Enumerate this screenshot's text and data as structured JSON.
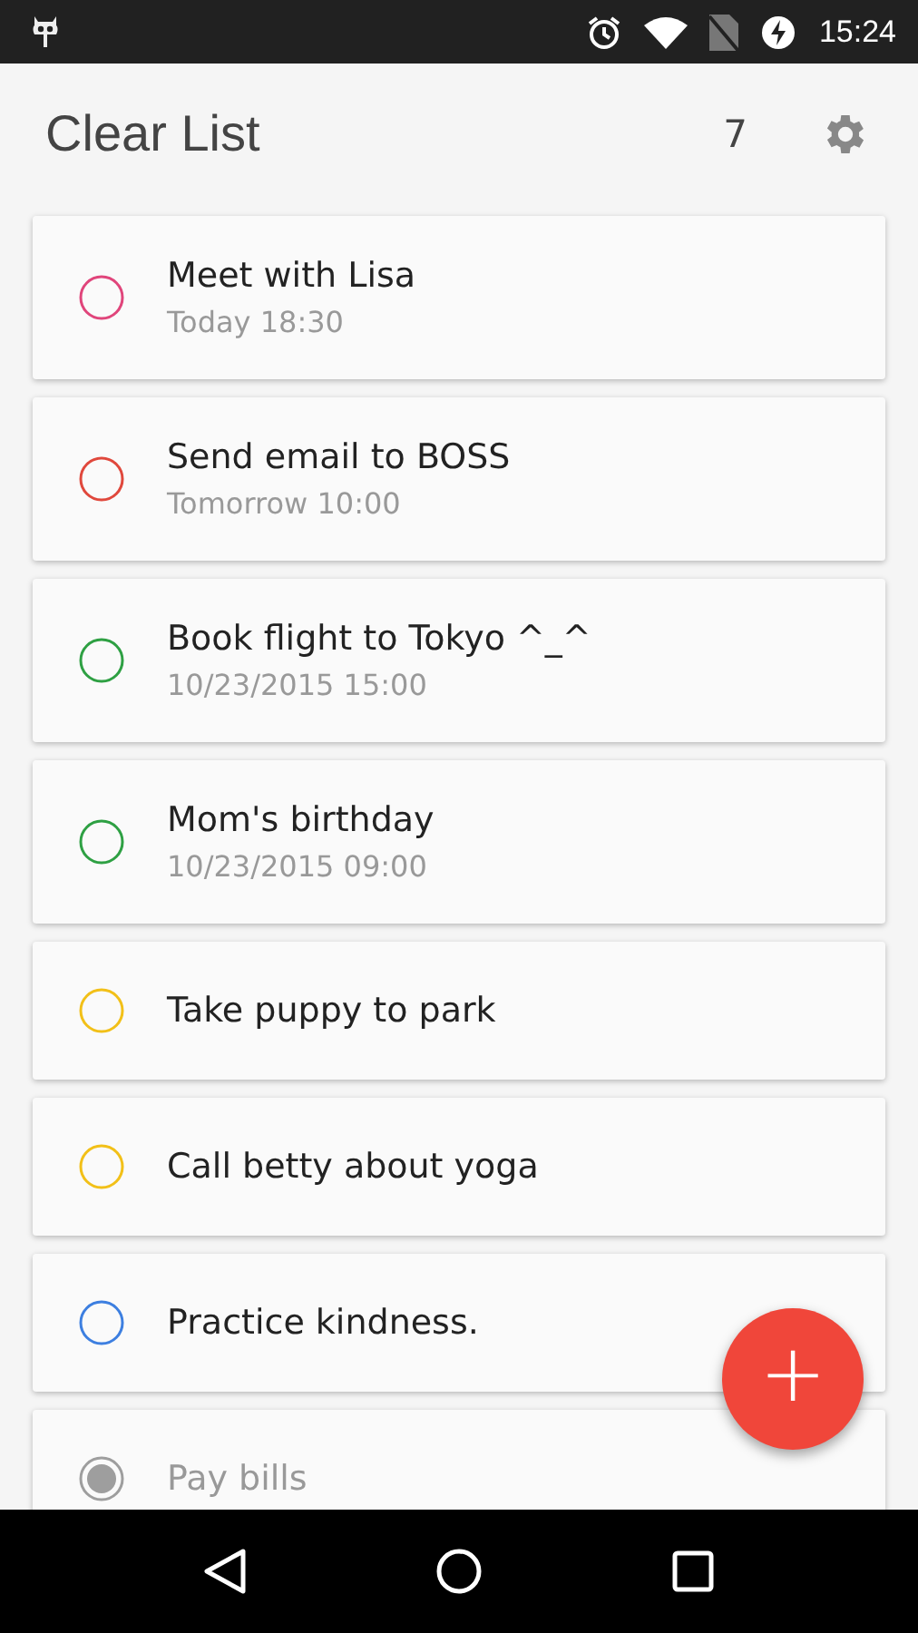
{
  "status_bar": {
    "time": "15:24"
  },
  "header": {
    "title": "Clear List",
    "count": "7"
  },
  "tasks": [
    {
      "title": "Meet with Lisa",
      "subtitle": "Today 18:30",
      "color": "#e0457b",
      "done": false
    },
    {
      "title": "Send email to BOSS",
      "subtitle": "Tomorrow 10:00",
      "color": "#e0483c",
      "done": false
    },
    {
      "title": "Book flight to Tokyo ^_^",
      "subtitle": "10/23/2015 15:00",
      "color": "#2ea043",
      "done": false
    },
    {
      "title": "Mom's birthday",
      "subtitle": "10/23/2015 09:00",
      "color": "#2ea043",
      "done": false
    },
    {
      "title": "Take puppy to park",
      "color": "#f2c018",
      "done": false
    },
    {
      "title": "Call betty about yoga",
      "color": "#f2c018",
      "done": false
    },
    {
      "title": "Practice kindness.",
      "color": "#3d7fe0",
      "done": false
    },
    {
      "title": "Pay bills",
      "color": "#9e9e9e",
      "done": true
    }
  ],
  "fab": {
    "label": "+"
  }
}
